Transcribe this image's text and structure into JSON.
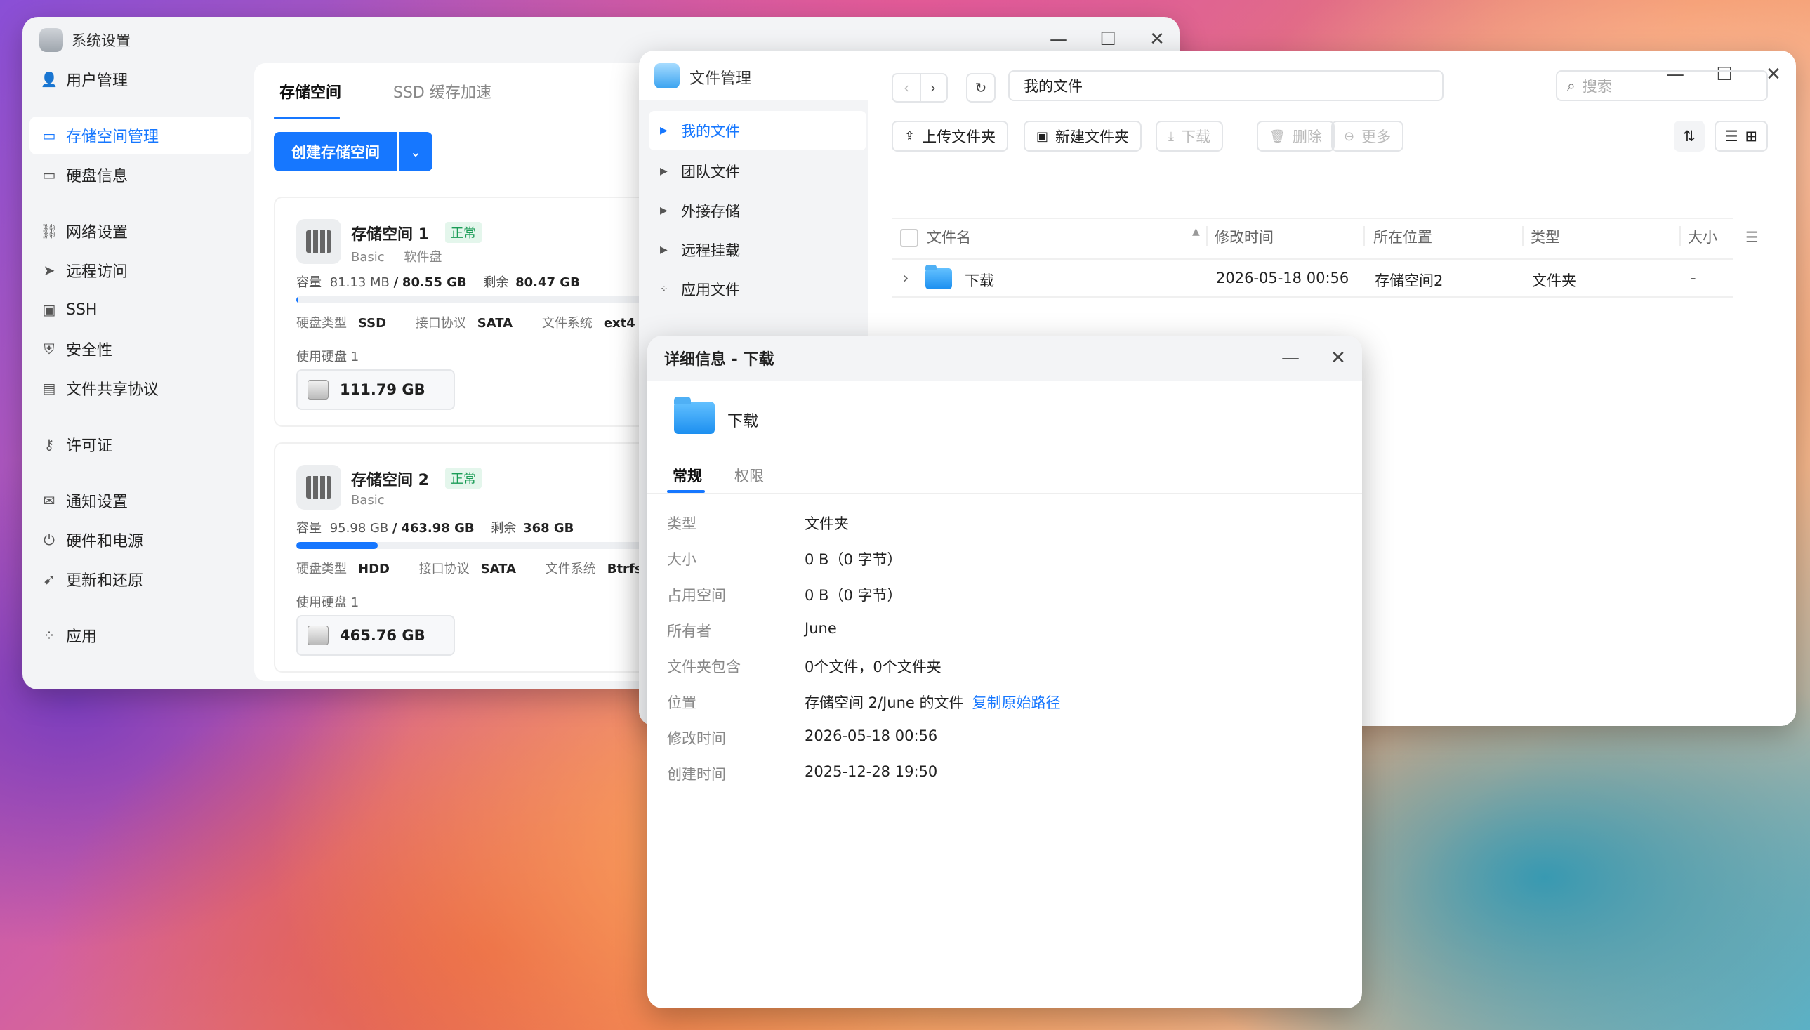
{
  "system_settings": {
    "title": "系统设置",
    "sidebar": [
      {
        "icon": "user-icon",
        "glyph": "👤",
        "label": "用户管理"
      },
      {
        "icon": "storage-icon",
        "glyph": "▭",
        "label": "存储空间管理",
        "active": true
      },
      {
        "icon": "disk-icon",
        "glyph": "▭",
        "label": "硬盘信息"
      },
      {
        "icon": "network-icon",
        "glyph": "⛓",
        "label": "网络设置"
      },
      {
        "icon": "send-icon",
        "glyph": "➤",
        "label": "远程访问"
      },
      {
        "icon": "ssh-icon",
        "glyph": "▣",
        "label": "SSH"
      },
      {
        "icon": "shield-icon",
        "glyph": "⛨",
        "label": "安全性"
      },
      {
        "icon": "document-icon",
        "glyph": "▤",
        "label": "文件共享协议"
      },
      {
        "icon": "key-icon",
        "glyph": "⚷",
        "label": "许可证"
      },
      {
        "icon": "mail-icon",
        "glyph": "✉",
        "label": "通知设置"
      },
      {
        "icon": "power-icon",
        "glyph": "⏻",
        "label": "硬件和电源"
      },
      {
        "icon": "rocket-icon",
        "glyph": "➹",
        "label": "更新和还原"
      },
      {
        "icon": "apps-icon",
        "glyph": "⁘",
        "label": "应用"
      }
    ],
    "tabs": [
      "存储空间",
      "SSD 缓存加速"
    ],
    "create_button": "创建存储空间",
    "pools": [
      {
        "name": "存储空间 1",
        "status": "正常",
        "subtitle_type": "Basic",
        "subtitle_extra": "软件盘",
        "cap_label": "容量",
        "used": "81.13 MB",
        "sep": "/",
        "total": "80.55 GB",
        "free_label": "剩余",
        "free": "80.47 GB",
        "usage_fraction": 0.001,
        "disk_type_label": "硬盘类型",
        "disk_type": "SSD",
        "iface_label": "接口协议",
        "iface": "SATA",
        "fs_label": "文件系统",
        "fs": "ext4",
        "use_label": "使用硬盘 1",
        "disk_size": "111.79 GB"
      },
      {
        "name": "存储空间 2",
        "status": "正常",
        "subtitle_type": "Basic",
        "subtitle_extra": "",
        "cap_label": "容量",
        "used": "95.98 GB",
        "sep": "/",
        "total": "463.98 GB",
        "free_label": "剩余",
        "free": "368 GB",
        "usage_fraction": 0.207,
        "disk_type_label": "硬盘类型",
        "disk_type": "HDD",
        "iface_label": "接口协议",
        "iface": "SATA",
        "fs_label": "文件系统",
        "fs": "Btrfs",
        "use_label": "使用硬盘 1",
        "disk_size": "465.76 GB"
      }
    ]
  },
  "file_manager": {
    "title": "文件管理",
    "nav": [
      {
        "label": "我的文件",
        "active": true
      },
      {
        "label": "团队文件"
      },
      {
        "label": "外接存储"
      },
      {
        "label": "远程挂载"
      },
      {
        "label": "应用文件"
      }
    ],
    "path": "我的文件",
    "search_placeholder": "搜索",
    "toolbar": {
      "upload": "上传文件夹",
      "new_folder": "新建文件夹",
      "download": "下载",
      "delete": "删除",
      "more": "更多"
    },
    "columns": {
      "name": "文件名",
      "modified": "修改时间",
      "location": "所在位置",
      "type": "类型",
      "size": "大小"
    },
    "rows": [
      {
        "name": "下载",
        "modified": "2026-05-18 00:56",
        "location": "存储空间2",
        "type": "文件夹",
        "size": "-"
      }
    ]
  },
  "details": {
    "title": "详细信息 - 下载",
    "name": "下载",
    "tabs": [
      "常规",
      "权限"
    ],
    "fields": [
      {
        "label": "类型",
        "value": "文件夹"
      },
      {
        "label": "大小",
        "value": "0 B（0 字节）"
      },
      {
        "label": "占用空间",
        "value": "0 B（0 字节）"
      },
      {
        "label": "所有者",
        "value": "June"
      },
      {
        "label": "文件夹包含",
        "value": "0个文件，0个文件夹"
      },
      {
        "label": "位置",
        "value": "存储空间 2/June 的文件"
      },
      {
        "label": "修改时间",
        "value": "2026-05-18 00:56"
      },
      {
        "label": "创建时间",
        "value": "2025-12-28 19:50"
      }
    ],
    "copy_path_link": "复制原始路径"
  }
}
